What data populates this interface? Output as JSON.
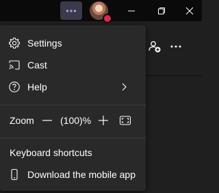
{
  "titlebar": {
    "more_icon": "ellipsis-icon",
    "avatar_status_color": "#e3264b",
    "accent_color": "#3a3a4a",
    "window_controls": [
      "minimize-icon",
      "maximize-icon",
      "close-icon"
    ]
  },
  "toolbar": {
    "icons": [
      "people-add-icon",
      "ellipsis-icon"
    ]
  },
  "menu": {
    "items": [
      {
        "label": "Settings",
        "icon": "gear-icon"
      },
      {
        "label": "Cast",
        "icon": "cast-icon"
      },
      {
        "label": "Help",
        "icon": "help-icon",
        "submenu": true
      }
    ],
    "zoom": {
      "label": "Zoom",
      "value": "(100)%"
    },
    "keyboard_shortcuts": "Keyboard shortcuts",
    "download_mobile": {
      "label": "Download the mobile app",
      "icon": "phone-icon"
    }
  }
}
